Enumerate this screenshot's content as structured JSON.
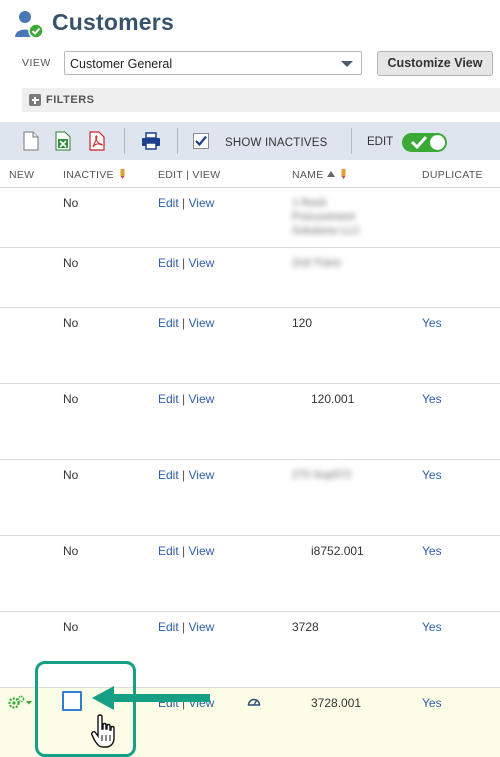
{
  "header": {
    "title": "Customers"
  },
  "view": {
    "label": "VIEW",
    "selected": "Customer General",
    "customize_label": "Customize View"
  },
  "filters": {
    "label": "FILTERS"
  },
  "toolbar": {
    "show_inactives_label": "SHOW INACTIVES",
    "show_inactives_checked": true,
    "edit_label": "EDIT",
    "edit_on": true
  },
  "columns": {
    "new": "NEW",
    "inactive": "INACTIVE",
    "edit_view": "EDIT | VIEW",
    "name": "NAME",
    "duplicate": "DUPLICATE"
  },
  "rows": [
    {
      "inactive": "No",
      "edit": "Edit",
      "view": "View",
      "name": "1 Rock Procurement Solutions LLC",
      "name_blurred": true,
      "duplicate": ""
    },
    {
      "inactive": "No",
      "edit": "Edit",
      "view": "View",
      "name": "2nd Trans",
      "name_blurred": true,
      "duplicate": ""
    },
    {
      "inactive": "No",
      "edit": "Edit",
      "view": "View",
      "name": "120",
      "name_blurred": false,
      "duplicate": "Yes"
    },
    {
      "inactive": "No",
      "edit": "Edit",
      "view": "View",
      "name": "120.001",
      "name_blurred": false,
      "duplicate": "Yes"
    },
    {
      "inactive": "No",
      "edit": "Edit",
      "view": "View",
      "name": "270 Sup572",
      "name_blurred": true,
      "duplicate": "Yes"
    },
    {
      "inactive": "No",
      "edit": "Edit",
      "view": "View",
      "name": "i8752.001",
      "name_blurred": false,
      "duplicate": "Yes"
    },
    {
      "inactive": "No",
      "edit": "Edit",
      "view": "View",
      "name": "3728",
      "name_blurred": false,
      "duplicate": "Yes"
    },
    {
      "inactive": "",
      "edit": "Edit",
      "view": "View",
      "name": "3728.001",
      "name_blurred": false,
      "duplicate": "Yes"
    }
  ],
  "colors": {
    "title": "#39526e",
    "link": "#2d5ea8",
    "toolbar_bg": "#dfe5ee",
    "toggle_on": "#3aa935",
    "annotation": "#15a085",
    "edit_row_bg": "#fbfde7"
  },
  "icons": {
    "header": "customer-user-icon",
    "toolbar": [
      "new-document-icon",
      "export-excel-icon",
      "export-pdf-icon",
      "print-icon"
    ],
    "new_row": "gear-add-icon",
    "row_status": "gauge-icon",
    "pointer": "hand-cursor-icon"
  }
}
